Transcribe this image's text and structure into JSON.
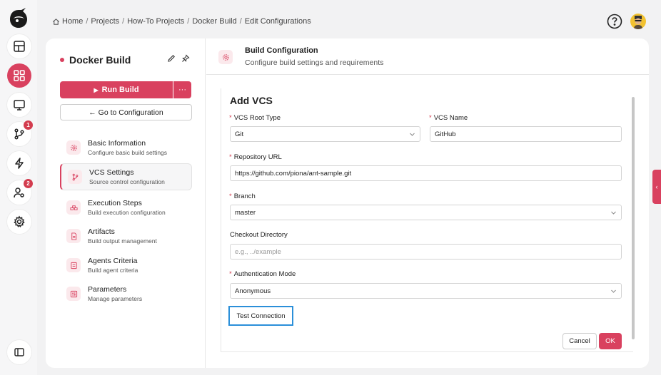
{
  "breadcrumb": {
    "items": [
      "Home",
      "Projects",
      "How-To Projects",
      "Docker Build",
      "Edit Configurations"
    ],
    "separator": "/"
  },
  "rail": {
    "badges": {
      "branches": "1",
      "users": "2"
    }
  },
  "sidebar": {
    "title": "Docker Build",
    "run_label": "Run Build",
    "run_more": "···",
    "goto_label": "← Go to Configuration",
    "items": [
      {
        "title": "Basic Information",
        "sub": "Configure basic build settings"
      },
      {
        "title": "VCS Settings",
        "sub": "Source control configuration"
      },
      {
        "title": "Execution Steps",
        "sub": "Build execution configuration"
      },
      {
        "title": "Artifacts",
        "sub": "Build output management"
      },
      {
        "title": "Agents Criteria",
        "sub": "Build agent criteria"
      },
      {
        "title": "Parameters",
        "sub": "Manage parameters"
      }
    ]
  },
  "panel": {
    "title": "Build Configuration",
    "subtitle": "Configure build settings and requirements"
  },
  "form": {
    "title": "Add VCS",
    "required_mark": "*",
    "vcs_root_type": {
      "label": "VCS Root Type",
      "value": "Git"
    },
    "vcs_name": {
      "label": "VCS Name",
      "value": "GitHub"
    },
    "repo_url": {
      "label": "Repository URL",
      "value": "https://github.com/piona/ant-sample.git"
    },
    "branch": {
      "label": "Branch",
      "value": "master"
    },
    "checkout_dir": {
      "label": "Checkout Directory",
      "placeholder": "e.g., ../example"
    },
    "auth_mode": {
      "label": "Authentication Mode",
      "value": "Anonymous"
    },
    "test_label": "Test Connection",
    "cancel_label": "Cancel",
    "ok_label": "OK"
  },
  "collapse_glyph": "‹",
  "colors": {
    "accent": "#d9415f",
    "focus": "#2b8fd9"
  }
}
